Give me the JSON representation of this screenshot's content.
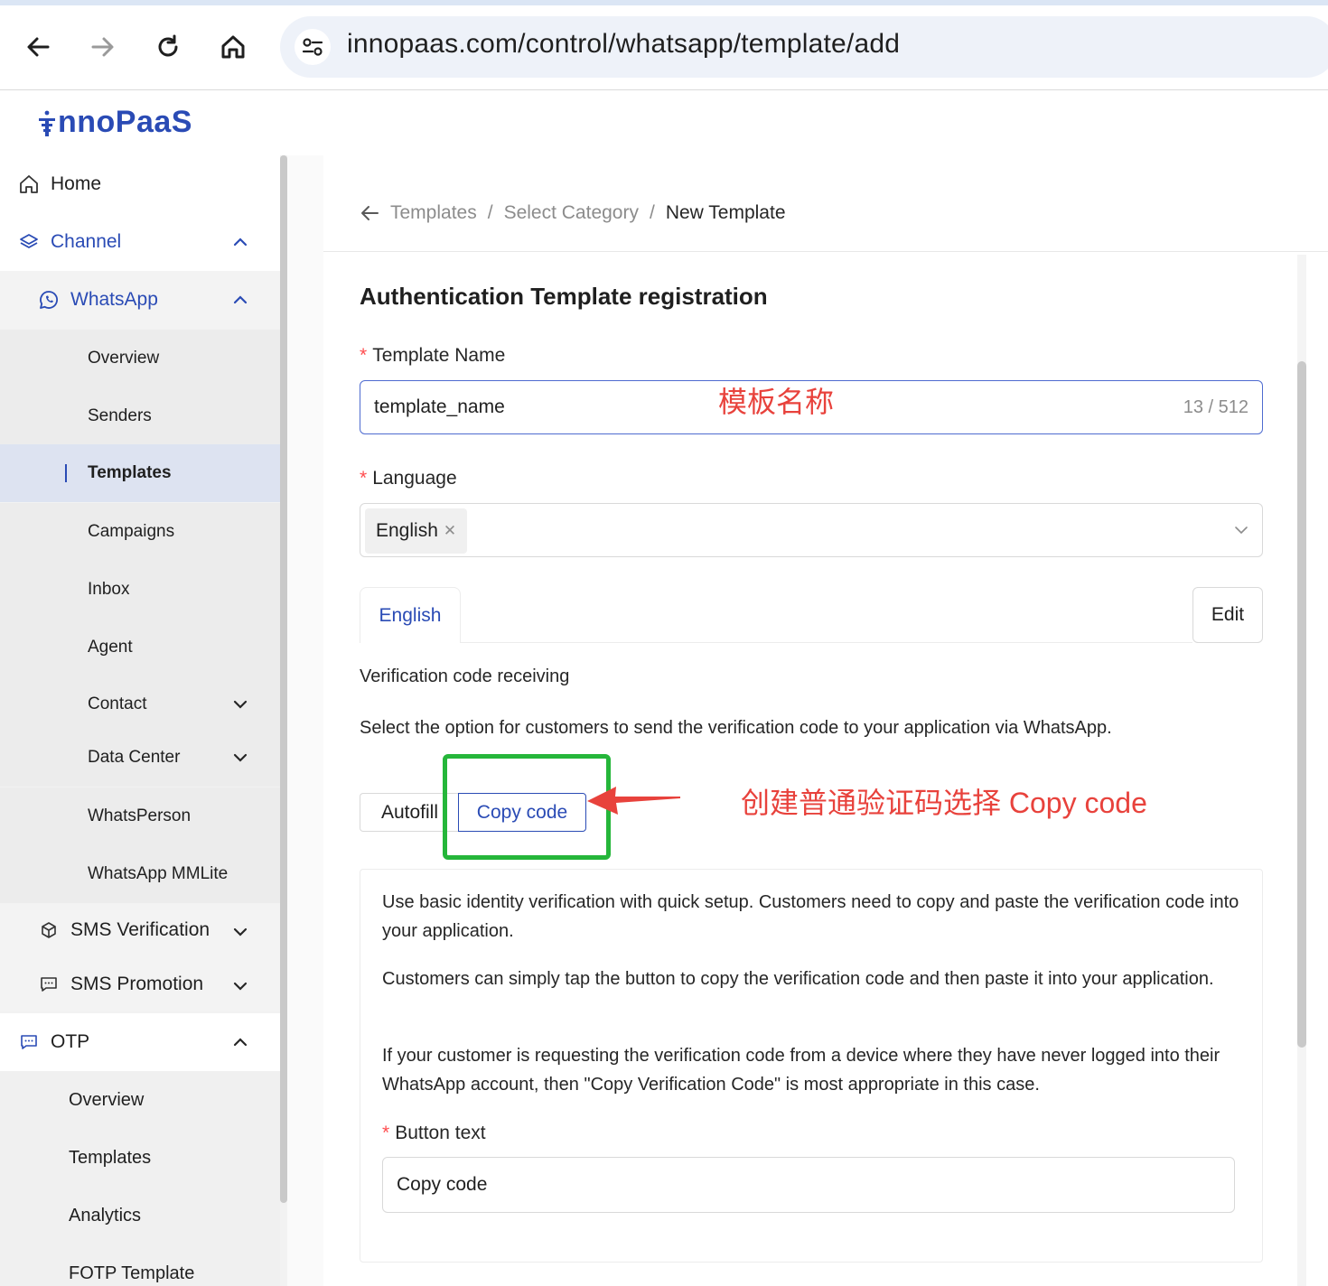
{
  "browser": {
    "url": "innopaas.com/control/whatsapp/template/add"
  },
  "logo": {
    "text": "nnoPaaS"
  },
  "sidebar": {
    "home": "Home",
    "channel": "Channel",
    "whatsapp": "WhatsApp",
    "whatsapp_items": [
      "Overview",
      "Senders",
      "Templates",
      "Campaigns",
      "Inbox",
      "Agent",
      "Contact",
      "Data Center",
      "WhatsPerson",
      "WhatsApp MMLite"
    ],
    "sms_verification": "SMS Verification",
    "sms_promotion": "SMS Promotion",
    "otp": "OTP",
    "otp_items": [
      "Overview",
      "Templates",
      "Analytics",
      "FOTP Template"
    ]
  },
  "breadcrumb": {
    "items": [
      "Templates",
      "Select Category",
      "New Template"
    ]
  },
  "page": {
    "title": "Authentication Template registration",
    "template_name_label": "Template Name",
    "template_name_value": "template_name",
    "template_name_count": "13 / 512",
    "language_label": "Language",
    "language_tag": "English",
    "tab_label": "English",
    "edit_label": "Edit",
    "verification_heading": "Verification code receiving",
    "verification_desc": "Select the option for customers to send the verification code to your application via WhatsApp.",
    "option_autofill": "Autofill",
    "option_copy_code": "Copy code",
    "desc_p1": "Use basic identity verification with quick setup. Customers need to copy and paste the verification code into your application.",
    "desc_p2": "Customers can simply tap the button to copy the verification code and then paste it into your application.",
    "desc_p3": "If your customer is requesting the verification code from a device where they have never logged into their WhatsApp account, then \"Copy Verification Code\" is most appropriate in this case.",
    "button_text_label": "Button text",
    "button_text_value": "Copy code"
  },
  "annotations": {
    "name_note": "模板名称",
    "copy_note": "创建普通验证码选择 Copy code"
  },
  "colors": {
    "brand": "#2a4bb5",
    "annotation_red": "#e8423c",
    "annotation_green": "#25b63a",
    "required": "#ff4d4f"
  }
}
